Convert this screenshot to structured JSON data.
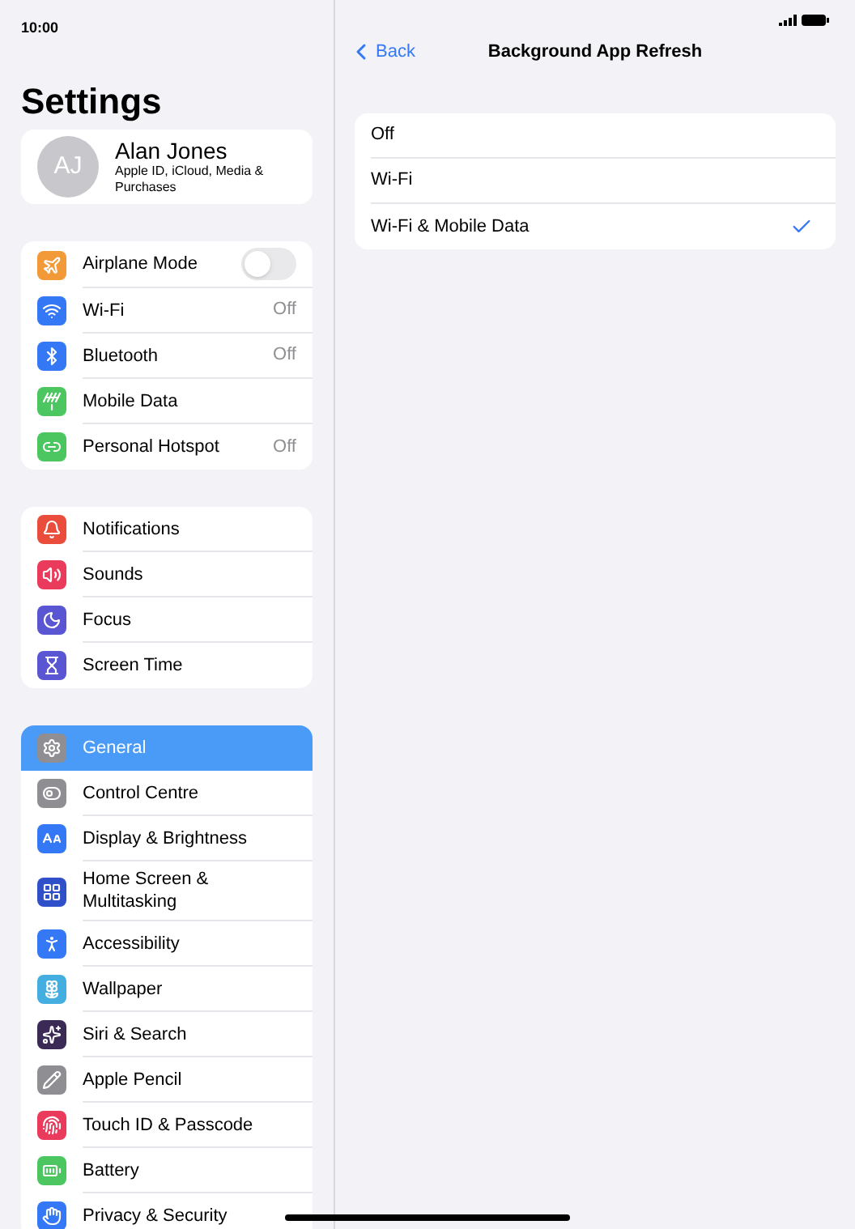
{
  "status_bar": {
    "time": "10:00"
  },
  "sidebar": {
    "title": "Settings",
    "profile": {
      "initials": "AJ",
      "name": "Alan Jones",
      "subtitle": "Apple ID, iCloud, Media & Purchases"
    },
    "groups": [
      {
        "items": [
          {
            "label": "Airplane Mode",
            "kind": "toggle",
            "on": false,
            "selected": false
          },
          {
            "label": "Wi-Fi",
            "kind": "value",
            "value": "Off",
            "selected": false
          },
          {
            "label": "Bluetooth",
            "kind": "value",
            "value": "Off",
            "selected": false
          },
          {
            "label": "Mobile Data",
            "kind": "plain",
            "selected": false
          },
          {
            "label": "Personal Hotspot",
            "kind": "value",
            "value": "Off",
            "selected": false
          }
        ]
      },
      {
        "items": [
          {
            "label": "Notifications",
            "kind": "plain",
            "selected": false
          },
          {
            "label": "Sounds",
            "kind": "plain",
            "selected": false
          },
          {
            "label": "Focus",
            "kind": "plain",
            "selected": false
          },
          {
            "label": "Screen Time",
            "kind": "plain",
            "selected": false
          }
        ]
      },
      {
        "items": [
          {
            "label": "General",
            "kind": "plain",
            "selected": true
          },
          {
            "label": "Control Centre",
            "kind": "plain",
            "selected": false
          },
          {
            "label": "Display & Brightness",
            "kind": "plain",
            "selected": false
          },
          {
            "label": "Home Screen & Multitasking",
            "kind": "plain",
            "selected": false
          },
          {
            "label": "Accessibility",
            "kind": "plain",
            "selected": false
          },
          {
            "label": "Wallpaper",
            "kind": "plain",
            "selected": false
          },
          {
            "label": "Siri & Search",
            "kind": "plain",
            "selected": false
          },
          {
            "label": "Apple Pencil",
            "kind": "plain",
            "selected": false
          },
          {
            "label": "Touch ID & Passcode",
            "kind": "plain",
            "selected": false
          },
          {
            "label": "Battery",
            "kind": "plain",
            "selected": false
          },
          {
            "label": "Privacy & Security",
            "kind": "plain",
            "selected": false
          }
        ]
      }
    ]
  },
  "detail": {
    "back": "Back",
    "title": "Background App Refresh",
    "options": [
      {
        "label": "Off",
        "selected": false
      },
      {
        "label": "Wi-Fi",
        "selected": false
      },
      {
        "label": "Wi-Fi & Mobile Data",
        "selected": true
      }
    ]
  }
}
